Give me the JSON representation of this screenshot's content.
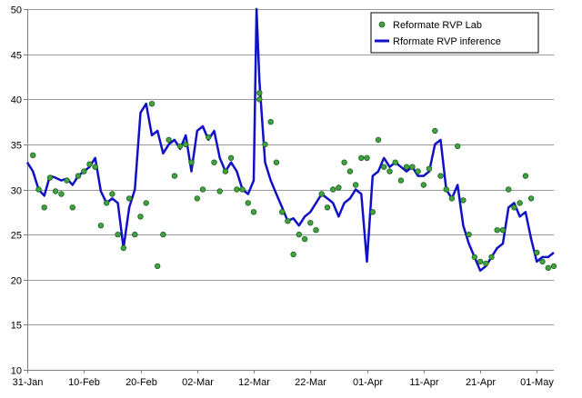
{
  "chart_data": {
    "type": "line",
    "title": "",
    "xlabel": "",
    "ylabel": "",
    "x_ticks": [
      "31-Jan",
      "10-Feb",
      "20-Feb",
      "02-Mar",
      "12-Mar",
      "22-Mar",
      "01-Apr",
      "11-Apr",
      "21-Apr",
      "01-May"
    ],
    "xlim": [
      "31-Jan",
      "04-May"
    ],
    "ylim": [
      10,
      50
    ],
    "y_ticks": [
      10,
      15,
      20,
      25,
      30,
      35,
      40,
      45,
      50
    ],
    "grid": "horizontal",
    "legend_position": "top-right",
    "colors": {
      "lab": "#3fa33f",
      "lab_edge": "#1f5f1f",
      "inference": "#1010c8",
      "grid": "#9a9a9a"
    },
    "series": [
      {
        "name": "Reformate RVP Lab",
        "kind": "scatter",
        "points": [
          [
            "01-Feb",
            33.8
          ],
          [
            "02-Feb",
            30.0
          ],
          [
            "03-Feb",
            28.0
          ],
          [
            "04-Feb",
            31.3
          ],
          [
            "05-Feb",
            29.8
          ],
          [
            "06-Feb",
            29.5
          ],
          [
            "07-Feb",
            31.0
          ],
          [
            "08-Feb",
            28.0
          ],
          [
            "09-Feb",
            31.5
          ],
          [
            "10-Feb",
            32.0
          ],
          [
            "11-Feb",
            32.8
          ],
          [
            "12-Feb",
            32.5
          ],
          [
            "13-Feb",
            26.0
          ],
          [
            "14-Feb",
            28.5
          ],
          [
            "15-Feb",
            29.5
          ],
          [
            "16-Feb",
            25.0
          ],
          [
            "17-Feb",
            23.5
          ],
          [
            "18-Feb",
            29.0
          ],
          [
            "19-Feb",
            25.0
          ],
          [
            "20-Feb",
            27.0
          ],
          [
            "21-Feb",
            28.5
          ],
          [
            "22-Feb",
            39.5
          ],
          [
            "23-Feb",
            21.5
          ],
          [
            "24-Feb",
            25.0
          ],
          [
            "25-Feb",
            35.5
          ],
          [
            "26-Feb",
            31.5
          ],
          [
            "27-Feb",
            34.8
          ],
          [
            "28-Feb",
            35.0
          ],
          [
            "01-Mar",
            33.0
          ],
          [
            "02-Mar",
            29.0
          ],
          [
            "03-Mar",
            30.0
          ],
          [
            "04-Mar",
            35.8
          ],
          [
            "05-Mar",
            33.0
          ],
          [
            "06-Mar",
            29.8
          ],
          [
            "07-Mar",
            32.0
          ],
          [
            "08-Mar",
            33.5
          ],
          [
            "09-Mar",
            30.0
          ],
          [
            "10-Mar",
            30.0
          ],
          [
            "11-Mar",
            28.5
          ],
          [
            "12-Mar",
            27.5
          ],
          [
            "13-Mar",
            40.0
          ],
          [
            "13-Mar",
            40.7
          ],
          [
            "14-Mar",
            35.0
          ],
          [
            "15-Mar",
            37.5
          ],
          [
            "16-Mar",
            33.0
          ],
          [
            "17-Mar",
            27.5
          ],
          [
            "18-Mar",
            26.5
          ],
          [
            "19-Mar",
            22.8
          ],
          [
            "20-Mar",
            25.0
          ],
          [
            "21-Mar",
            24.5
          ],
          [
            "22-Mar",
            26.3
          ],
          [
            "23-Mar",
            25.5
          ],
          [
            "24-Mar",
            29.5
          ],
          [
            "25-Mar",
            28.0
          ],
          [
            "26-Mar",
            30.0
          ],
          [
            "27-Mar",
            30.2
          ],
          [
            "28-Mar",
            33.0
          ],
          [
            "29-Mar",
            32.0
          ],
          [
            "30-Mar",
            30.5
          ],
          [
            "31-Mar",
            33.5
          ],
          [
            "01-Apr",
            33.5
          ],
          [
            "02-Apr",
            27.5
          ],
          [
            "03-Apr",
            35.5
          ],
          [
            "04-Apr",
            32.5
          ],
          [
            "05-Apr",
            32.0
          ],
          [
            "06-Apr",
            33.0
          ],
          [
            "07-Apr",
            31.0
          ],
          [
            "08-Apr",
            32.5
          ],
          [
            "09-Apr",
            32.5
          ],
          [
            "10-Apr",
            32.0
          ],
          [
            "11-Apr",
            30.5
          ],
          [
            "12-Apr",
            32.3
          ],
          [
            "13-Apr",
            36.5
          ],
          [
            "14-Apr",
            31.5
          ],
          [
            "15-Apr",
            30.0
          ],
          [
            "16-Apr",
            29.0
          ],
          [
            "17-Apr",
            34.8
          ],
          [
            "18-Apr",
            28.8
          ],
          [
            "19-Apr",
            25.0
          ],
          [
            "20-Apr",
            22.5
          ],
          [
            "21-Apr",
            22.0
          ],
          [
            "22-Apr",
            21.8
          ],
          [
            "23-Apr",
            22.5
          ],
          [
            "24-Apr",
            25.5
          ],
          [
            "25-Apr",
            25.5
          ],
          [
            "26-Apr",
            30.0
          ],
          [
            "27-Apr",
            28.0
          ],
          [
            "28-Apr",
            28.5
          ],
          [
            "29-Apr",
            31.5
          ],
          [
            "30-Apr",
            29.0
          ],
          [
            "01-May",
            23.0
          ],
          [
            "02-May",
            22.0
          ],
          [
            "03-May",
            21.3
          ],
          [
            "04-May",
            21.5
          ]
        ]
      },
      {
        "name": "Rformate RVP inference",
        "kind": "line",
        "points": [
          [
            "31-Jan",
            33.0
          ],
          [
            "01-Feb",
            32.0
          ],
          [
            "02-Feb",
            30.0
          ],
          [
            "03-Feb",
            29.3
          ],
          [
            "04-Feb",
            31.5
          ],
          [
            "05-Feb",
            31.3
          ],
          [
            "06-Feb",
            31.0
          ],
          [
            "07-Feb",
            31.2
          ],
          [
            "08-Feb",
            30.5
          ],
          [
            "09-Feb",
            31.5
          ],
          [
            "10-Feb",
            32.0
          ],
          [
            "11-Feb",
            32.5
          ],
          [
            "12-Feb",
            33.5
          ],
          [
            "13-Feb",
            29.8
          ],
          [
            "14-Feb",
            28.5
          ],
          [
            "15-Feb",
            29.0
          ],
          [
            "16-Feb",
            28.5
          ],
          [
            "17-Feb",
            23.5
          ],
          [
            "18-Feb",
            28.0
          ],
          [
            "19-Feb",
            30.0
          ],
          [
            "20-Feb",
            38.5
          ],
          [
            "21-Feb",
            39.5
          ],
          [
            "22-Feb",
            36.0
          ],
          [
            "23-Feb",
            36.5
          ],
          [
            "24-Feb",
            34.0
          ],
          [
            "25-Feb",
            35.0
          ],
          [
            "26-Feb",
            35.5
          ],
          [
            "27-Feb",
            34.5
          ],
          [
            "28-Feb",
            36.0
          ],
          [
            "01-Mar",
            32.0
          ],
          [
            "02-Mar",
            36.5
          ],
          [
            "03-Mar",
            37.0
          ],
          [
            "04-Mar",
            35.5
          ],
          [
            "05-Mar",
            36.5
          ],
          [
            "06-Mar",
            33.5
          ],
          [
            "07-Mar",
            32.0
          ],
          [
            "08-Mar",
            33.0
          ],
          [
            "09-Mar",
            32.0
          ],
          [
            "10-Mar",
            30.0
          ],
          [
            "11-Mar",
            29.5
          ],
          [
            "12-Mar",
            31.0
          ],
          [
            "12.5-Mar",
            50.0
          ],
          [
            "13-Mar",
            42.0
          ],
          [
            "14-Mar",
            33.0
          ],
          [
            "15-Mar",
            31.0
          ],
          [
            "16-Mar",
            29.5
          ],
          [
            "17-Mar",
            28.0
          ],
          [
            "18-Mar",
            26.5
          ],
          [
            "19-Mar",
            26.8
          ],
          [
            "20-Mar",
            26.0
          ],
          [
            "21-Mar",
            27.0
          ],
          [
            "22-Mar",
            27.5
          ],
          [
            "23-Mar",
            28.5
          ],
          [
            "24-Mar",
            29.5
          ],
          [
            "25-Mar",
            29.0
          ],
          [
            "26-Mar",
            28.5
          ],
          [
            "27-Mar",
            27.0
          ],
          [
            "28-Mar",
            28.5
          ],
          [
            "29-Mar",
            29.0
          ],
          [
            "30-Mar",
            30.0
          ],
          [
            "31-Mar",
            29.5
          ],
          [
            "01-Apr",
            22.0
          ],
          [
            "02-Apr",
            31.5
          ],
          [
            "03-Apr",
            32.0
          ],
          [
            "04-Apr",
            33.5
          ],
          [
            "05-Apr",
            32.5
          ],
          [
            "06-Apr",
            33.0
          ],
          [
            "07-Apr",
            32.5
          ],
          [
            "08-Apr",
            32.0
          ],
          [
            "09-Apr",
            32.5
          ],
          [
            "10-Apr",
            31.5
          ],
          [
            "11-Apr",
            31.5
          ],
          [
            "12-Apr",
            32.0
          ],
          [
            "13-Apr",
            35.0
          ],
          [
            "14-Apr",
            35.5
          ],
          [
            "15-Apr",
            30.0
          ],
          [
            "16-Apr",
            29.0
          ],
          [
            "17-Apr",
            30.5
          ],
          [
            "18-Apr",
            26.0
          ],
          [
            "19-Apr",
            24.0
          ],
          [
            "20-Apr",
            22.5
          ],
          [
            "21-Apr",
            21.0
          ],
          [
            "22-Apr",
            21.5
          ],
          [
            "23-Apr",
            22.5
          ],
          [
            "24-Apr",
            23.5
          ],
          [
            "25-Apr",
            24.0
          ],
          [
            "26-Apr",
            28.0
          ],
          [
            "27-Apr",
            28.5
          ],
          [
            "28-Apr",
            27.0
          ],
          [
            "29-Apr",
            27.5
          ],
          [
            "30-Apr",
            24.5
          ],
          [
            "01-May",
            22.0
          ],
          [
            "02-May",
            22.5
          ],
          [
            "03-May",
            22.5
          ],
          [
            "04-May",
            23.0
          ]
        ]
      }
    ]
  }
}
